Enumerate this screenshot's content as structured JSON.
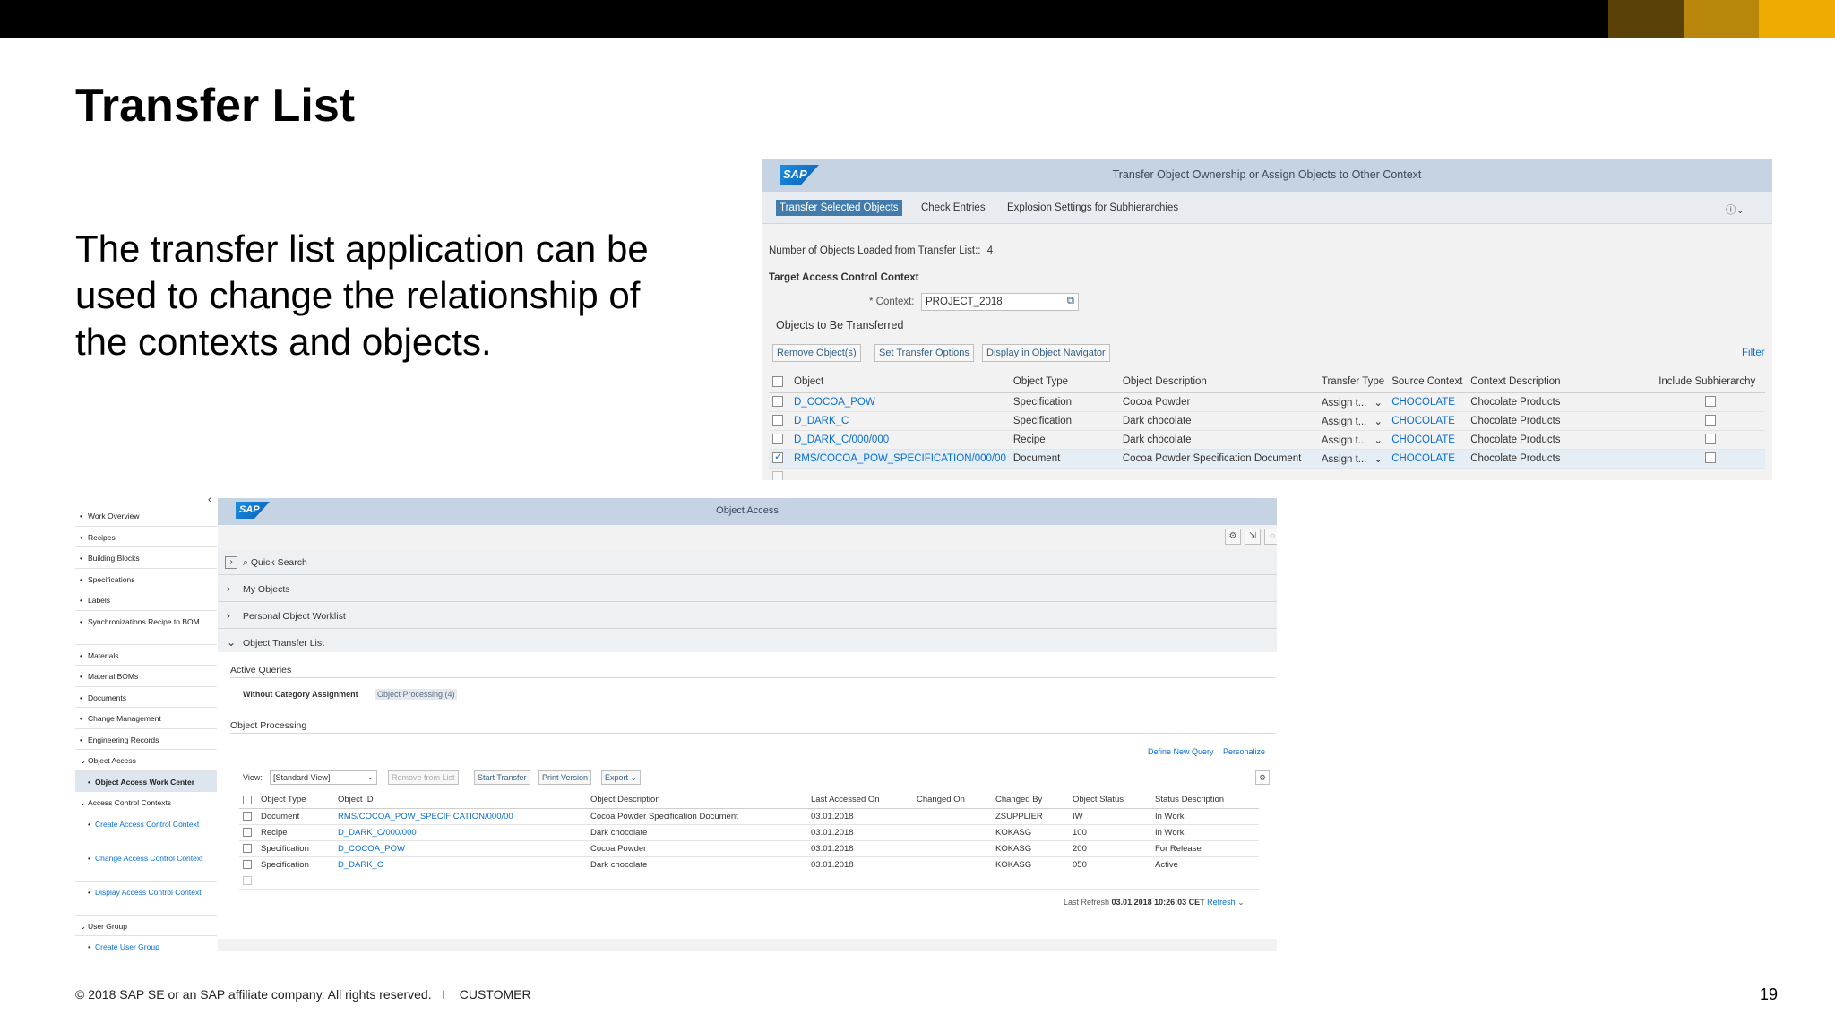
{
  "brand_colors": [
    "#000000",
    "#5a4108",
    "#b8860b",
    "#f0ab00"
  ],
  "slide": {
    "title": "Transfer List",
    "body": "The transfer list application can be used to change the relationship of the contexts and objects.",
    "footer": "© 2018 SAP SE or an SAP affiliate company. All rights reserved.   I    CUSTOMER",
    "page_number": "19"
  },
  "screen1": {
    "logo": "SAP",
    "title": "Transfer Object Ownership or Assign Objects to Other Context",
    "toolbar": [
      "Transfer Selected Objects",
      "Check Entries",
      "Explosion Settings for Subhierarchies"
    ],
    "help_icon": "help-icon",
    "objects_loaded_label": "Number of Objects Loaded from Transfer List::",
    "objects_loaded_value": "4",
    "target_heading": "Target Access Control Context",
    "context_label": "* Context:",
    "context_value": "PROJECT_2018",
    "section_title": "Objects to Be Transferred",
    "buttons": [
      "Remove Object(s)",
      "Set Transfer Options",
      "Display in Object Navigator"
    ],
    "filter": "Filter",
    "columns": [
      "Object",
      "Object Type",
      "Object Description",
      "Transfer Type",
      "Source Context",
      "Context Description",
      "Include Subhierarchy"
    ],
    "rows": [
      {
        "object": "D_COCOA_POW",
        "type": "Specification",
        "desc": "Cocoa Powder",
        "transfer": "Assign t...",
        "source": "CHOCOLATE",
        "ctx_desc": "Chocolate Products",
        "checked": false
      },
      {
        "object": "D_DARK_C",
        "type": "Specification",
        "desc": "Dark chocolate",
        "transfer": "Assign t...",
        "source": "CHOCOLATE",
        "ctx_desc": "Chocolate Products",
        "checked": false
      },
      {
        "object": "D_DARK_C/000/000",
        "type": "Recipe",
        "desc": "Dark chocolate",
        "transfer": "Assign t...",
        "source": "CHOCOLATE",
        "ctx_desc": "Chocolate Products",
        "checked": false
      },
      {
        "object": "RMS/COCOA_POW_SPECIFICATION/000/00",
        "type": "Document",
        "desc": "Cocoa Powder Specification Document",
        "transfer": "Assign t...",
        "source": "CHOCOLATE",
        "ctx_desc": "Chocolate Products",
        "checked": true
      }
    ]
  },
  "sidebar": {
    "items": [
      "Work Overview",
      "Recipes",
      "Building Blocks",
      "Specifications",
      "Labels",
      "Synchronizations Recipe to BOM",
      "Materials",
      "Material BOMs",
      "Documents",
      "Change Management",
      "Engineering Records",
      "Object Access",
      "Object Access Work Center",
      "Access Control Contexts",
      "Create Access Control Context",
      "Change Access Control Context",
      "Display Access Control Context",
      "User Group",
      "Create User Group"
    ]
  },
  "screen2": {
    "logo": "SAP",
    "title": "Object Access",
    "quick_search": "Quick Search",
    "sections": [
      "My Objects",
      "Personal Object Worklist",
      "Object Transfer List"
    ],
    "active_queries": "Active Queries",
    "without_category": "Without Category Assignment",
    "object_processing_link": "Object Processing (4)",
    "object_processing": "Object Processing",
    "define_query": "Define New Query",
    "personalize": "Personalize",
    "view_label": "View:",
    "view_value": "[Standard View]",
    "buttons": [
      "Remove from List",
      "Start Transfer",
      "Print Version",
      "Export"
    ],
    "columns": [
      "Object Type",
      "Object ID",
      "Object Description",
      "Last Accessed On",
      "Changed On",
      "Changed By",
      "Object Status",
      "Status Description"
    ],
    "rows": [
      {
        "type": "Document",
        "id": "RMS/COCOA_POW_SPECIFICATION/000/00",
        "desc": "Cocoa Powder Specification Document",
        "accessed": "03.01.2018",
        "changed_on": "",
        "changed_by": "ZSUPPLIER",
        "status": "IW",
        "status_desc": "In Work"
      },
      {
        "type": "Recipe",
        "id": "D_DARK_C/000/000",
        "desc": "Dark chocolate",
        "accessed": "03.01.2018",
        "changed_on": "",
        "changed_by": "KOKASG",
        "status": "100",
        "status_desc": "In Work"
      },
      {
        "type": "Specification",
        "id": "D_COCOA_POW",
        "desc": "Cocoa Powder",
        "accessed": "03.01.2018",
        "changed_on": "",
        "changed_by": "KOKASG",
        "status": "200",
        "status_desc": "For Release"
      },
      {
        "type": "Specification",
        "id": "D_DARK_C",
        "desc": "Dark chocolate",
        "accessed": "03.01.2018",
        "changed_on": "",
        "changed_by": "KOKASG",
        "status": "050",
        "status_desc": "Active"
      }
    ],
    "last_refresh_label": "Last Refresh",
    "last_refresh_value": "03.01.2018 10:26:03 CET",
    "refresh": "Refresh"
  }
}
